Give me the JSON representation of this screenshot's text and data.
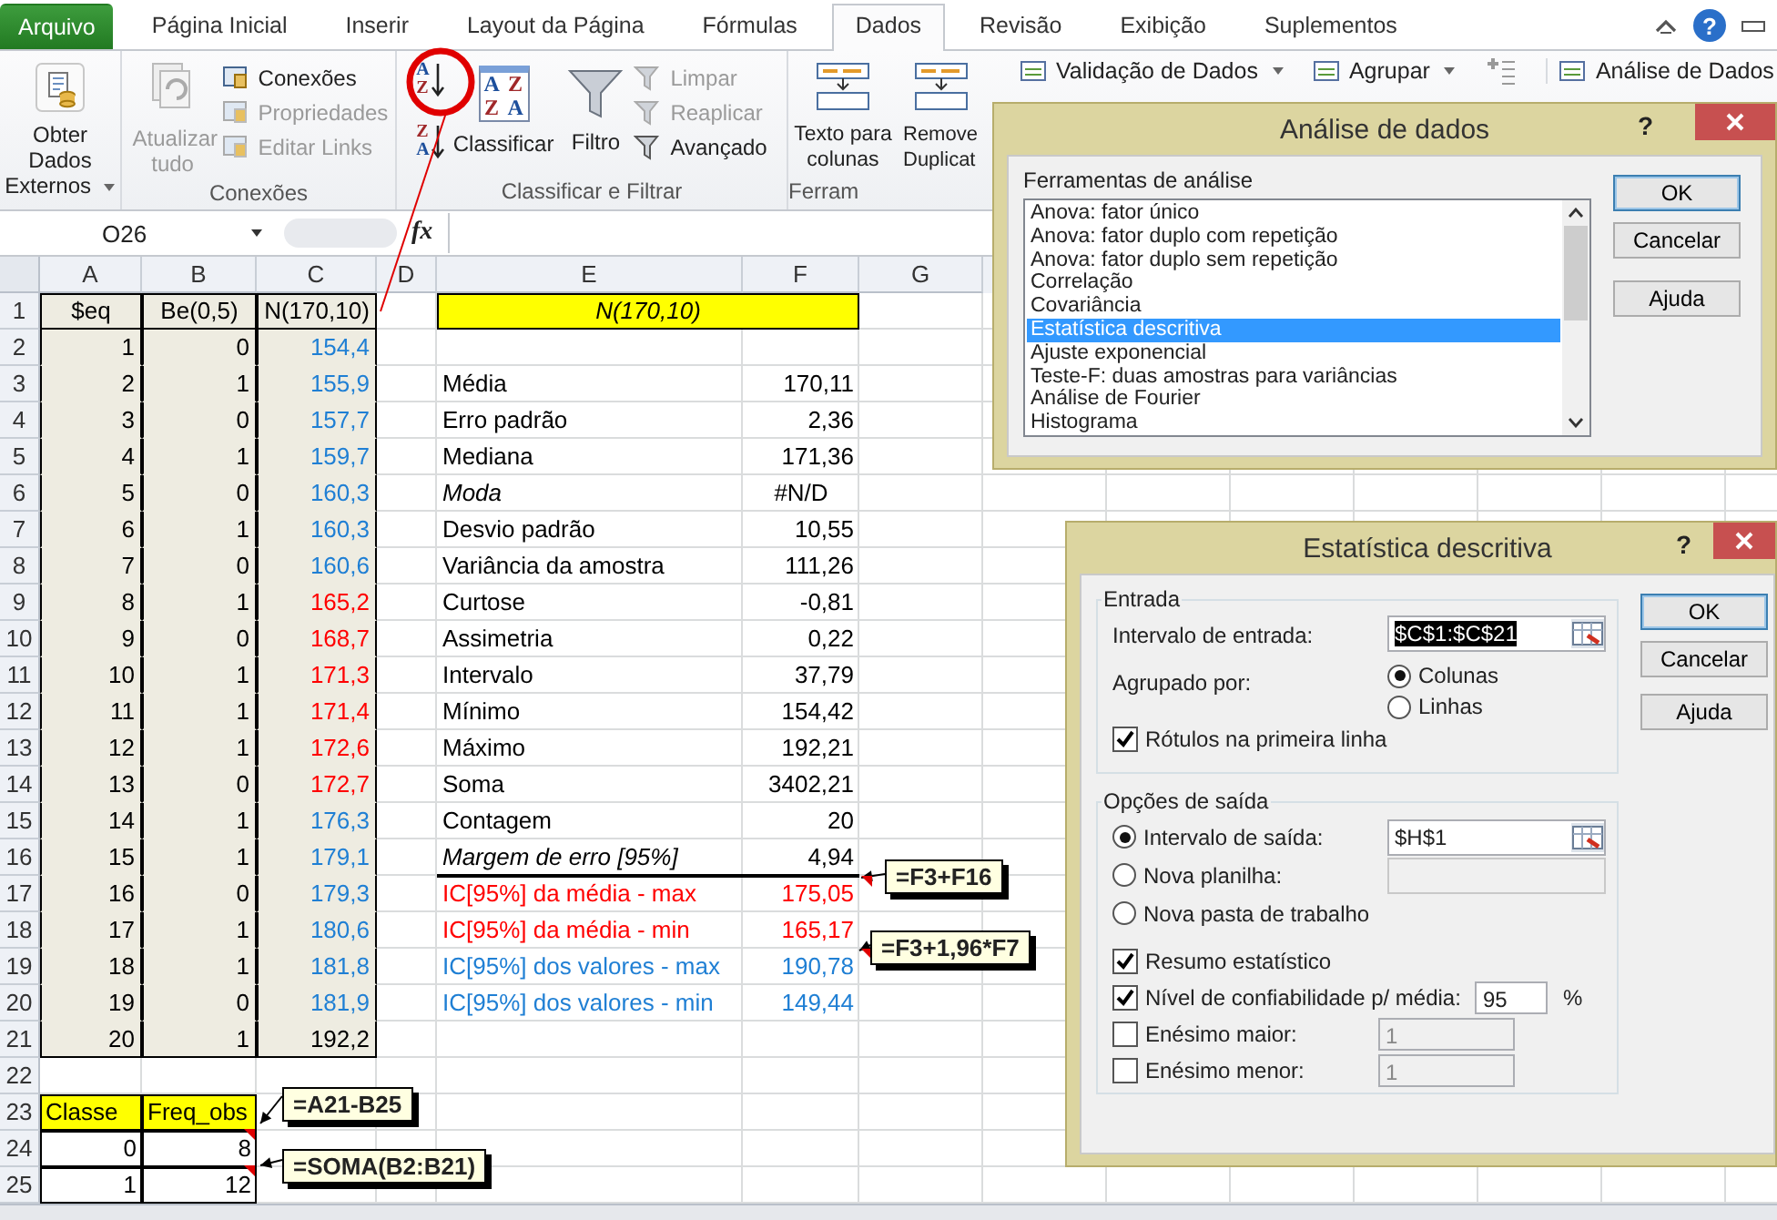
{
  "tabs": [
    {
      "label": "Arquivo",
      "kind": "file",
      "selected": false
    },
    {
      "label": "Página Inicial",
      "kind": "tab",
      "selected": false
    },
    {
      "label": "Inserir",
      "kind": "tab",
      "selected": false
    },
    {
      "label": "Layout da Página",
      "kind": "tab",
      "selected": false
    },
    {
      "label": "Fórmulas",
      "kind": "tab",
      "selected": false
    },
    {
      "label": "Dados",
      "kind": "tab",
      "selected": true
    },
    {
      "label": "Revisão",
      "kind": "tab",
      "selected": false
    },
    {
      "label": "Exibição",
      "kind": "tab",
      "selected": false
    },
    {
      "label": "Suplementos",
      "kind": "tab",
      "selected": false
    }
  ],
  "help": "?",
  "ribbon": {
    "external": {
      "label": "Obter Dados Externos"
    },
    "connections": {
      "refresh": {
        "label": "Atualizar tudo",
        "disabled": true
      },
      "items": [
        {
          "label": "Conexões",
          "disabled": false
        },
        {
          "label": "Propriedades",
          "disabled": true
        },
        {
          "label": "Editar Links",
          "disabled": true
        }
      ],
      "group_label": "Conexões"
    },
    "sort_filter": {
      "sort_buttons": [
        {
          "letters": [
            "A",
            "Z"
          ]
        },
        {
          "letters": [
            "Z",
            "A"
          ]
        }
      ],
      "sort": {
        "label": "Classificar",
        "letters": [
          "A",
          "Z",
          "Z",
          "A"
        ]
      },
      "filter": {
        "label": "Filtro"
      },
      "items": [
        {
          "label": "Limpar",
          "disabled": true
        },
        {
          "label": "Reaplicar",
          "disabled": true
        },
        {
          "label": "Avançado",
          "disabled": false
        }
      ],
      "group_label": "Classificar e Filtrar"
    },
    "tools": {
      "items": [
        {
          "label": "Texto para colunas"
        },
        {
          "label": "Remove Duplicat"
        }
      ],
      "group_label": "Ferram"
    },
    "right_items": [
      {
        "label": "Validação de Dados",
        "dropdown": true
      },
      {
        "label": "Agrupar",
        "dropdown": true
      },
      {
        "label": "Análise de Dados",
        "dropdown": false
      }
    ]
  },
  "formula_bar": {
    "name_box": "O26",
    "fx": "fx"
  },
  "sheet": {
    "columns": [
      "A",
      "B",
      "C",
      "D",
      "E",
      "F",
      "G"
    ],
    "rows": [
      {
        "number": "1",
        "cells": [
          {
            "text": "$eq",
            "kind": "head"
          },
          {
            "text": "Be(0,5)",
            "kind": "head"
          },
          {
            "text": "N(170,10)",
            "kind": "head"
          },
          {},
          {
            "text": "N(170,10)",
            "kind": "merged-head"
          }
        ]
      },
      {
        "number": "2",
        "cells": [
          {
            "text": "1",
            "kind": "num"
          },
          {
            "text": "0",
            "kind": "num"
          },
          {
            "text": "154,4",
            "kind": "num",
            "color": "#1f7fd4"
          }
        ]
      },
      {
        "number": "3",
        "cells": [
          {
            "text": "2",
            "kind": "num"
          },
          {
            "text": "1",
            "kind": "num"
          },
          {
            "text": "155,9",
            "kind": "num",
            "color": "#1f7fd4"
          },
          {},
          {
            "text": "Média",
            "kind": "label"
          },
          {
            "text": "170,11",
            "kind": "value"
          }
        ]
      },
      {
        "number": "4",
        "cells": [
          {
            "text": "3",
            "kind": "num"
          },
          {
            "text": "0",
            "kind": "num"
          },
          {
            "text": "157,7",
            "kind": "num",
            "color": "#1f7fd4"
          },
          {},
          {
            "text": "Erro padrão",
            "kind": "label"
          },
          {
            "text": "2,36",
            "kind": "value"
          }
        ]
      },
      {
        "number": "5",
        "cells": [
          {
            "text": "4",
            "kind": "num"
          },
          {
            "text": "1",
            "kind": "num"
          },
          {
            "text": "159,7",
            "kind": "num",
            "color": "#1f7fd4"
          },
          {},
          {
            "text": "Mediana",
            "kind": "label"
          },
          {
            "text": "171,36",
            "kind": "value"
          }
        ]
      },
      {
        "number": "6",
        "cells": [
          {
            "text": "5",
            "kind": "num"
          },
          {
            "text": "0",
            "kind": "num"
          },
          {
            "text": "160,3",
            "kind": "num",
            "color": "#1f7fd4"
          },
          {},
          {
            "text": "Moda",
            "kind": "label",
            "italic": true
          },
          {
            "text": "#N/D",
            "kind": "center"
          }
        ]
      },
      {
        "number": "7",
        "cells": [
          {
            "text": "6",
            "kind": "num"
          },
          {
            "text": "1",
            "kind": "num"
          },
          {
            "text": "160,3",
            "kind": "num",
            "color": "#1f7fd4"
          },
          {},
          {
            "text": "Desvio padrão",
            "kind": "label"
          },
          {
            "text": "10,55",
            "kind": "value"
          }
        ]
      },
      {
        "number": "8",
        "cells": [
          {
            "text": "7",
            "kind": "num"
          },
          {
            "text": "0",
            "kind": "num"
          },
          {
            "text": "160,6",
            "kind": "num",
            "color": "#1f7fd4"
          },
          {},
          {
            "text": "Variância da amostra",
            "kind": "label"
          },
          {
            "text": "111,26",
            "kind": "value"
          }
        ]
      },
      {
        "number": "9",
        "cells": [
          {
            "text": "8",
            "kind": "num"
          },
          {
            "text": "1",
            "kind": "num"
          },
          {
            "text": "165,2",
            "kind": "num",
            "color": "#ff0000"
          },
          {},
          {
            "text": "Curtose",
            "kind": "label"
          },
          {
            "text": "-0,81",
            "kind": "value"
          }
        ]
      },
      {
        "number": "10",
        "cells": [
          {
            "text": "9",
            "kind": "num"
          },
          {
            "text": "0",
            "kind": "num"
          },
          {
            "text": "168,7",
            "kind": "num",
            "color": "#ff0000"
          },
          {},
          {
            "text": "Assimetria",
            "kind": "label"
          },
          {
            "text": "0,22",
            "kind": "value"
          }
        ]
      },
      {
        "number": "11",
        "cells": [
          {
            "text": "10",
            "kind": "num"
          },
          {
            "text": "1",
            "kind": "num"
          },
          {
            "text": "171,3",
            "kind": "num",
            "color": "#ff0000"
          },
          {},
          {
            "text": "Intervalo",
            "kind": "label"
          },
          {
            "text": "37,79",
            "kind": "value"
          }
        ]
      },
      {
        "number": "12",
        "cells": [
          {
            "text": "11",
            "kind": "num"
          },
          {
            "text": "1",
            "kind": "num"
          },
          {
            "text": "171,4",
            "kind": "num",
            "color": "#ff0000"
          },
          {},
          {
            "text": "Mínimo",
            "kind": "label"
          },
          {
            "text": "154,42",
            "kind": "value"
          }
        ]
      },
      {
        "number": "13",
        "cells": [
          {
            "text": "12",
            "kind": "num"
          },
          {
            "text": "1",
            "kind": "num"
          },
          {
            "text": "172,6",
            "kind": "num",
            "color": "#ff0000"
          },
          {},
          {
            "text": "Máximo",
            "kind": "label"
          },
          {
            "text": "192,21",
            "kind": "value"
          }
        ]
      },
      {
        "number": "14",
        "cells": [
          {
            "text": "13",
            "kind": "num"
          },
          {
            "text": "0",
            "kind": "num"
          },
          {
            "text": "172,7",
            "kind": "num",
            "color": "#ff0000"
          },
          {},
          {
            "text": "Soma",
            "kind": "label"
          },
          {
            "text": "3402,21",
            "kind": "value"
          }
        ]
      },
      {
        "number": "15",
        "cells": [
          {
            "text": "14",
            "kind": "num"
          },
          {
            "text": "1",
            "kind": "num"
          },
          {
            "text": "176,3",
            "kind": "num",
            "color": "#1f7fd4"
          },
          {},
          {
            "text": "Contagem",
            "kind": "label"
          },
          {
            "text": "20",
            "kind": "value"
          }
        ]
      },
      {
        "number": "16",
        "cells": [
          {
            "text": "15",
            "kind": "num"
          },
          {
            "text": "1",
            "kind": "num"
          },
          {
            "text": "179,1",
            "kind": "num",
            "color": "#1f7fd4"
          },
          {},
          {
            "text": "Margem de erro [95%]",
            "kind": "label",
            "italic": true,
            "ruled": true
          },
          {
            "text": "4,94",
            "kind": "value",
            "ruled": true
          }
        ]
      },
      {
        "number": "17",
        "cells": [
          {
            "text": "16",
            "kind": "num"
          },
          {
            "text": "0",
            "kind": "num"
          },
          {
            "text": "179,3",
            "kind": "num",
            "color": "#1f7fd4"
          },
          {},
          {
            "text": "IC[95%] da média - max",
            "kind": "label",
            "color": "#ff0000"
          },
          {
            "text": "175,05",
            "kind": "value",
            "color": "#ff0000"
          }
        ]
      },
      {
        "number": "18",
        "cells": [
          {
            "text": "17",
            "kind": "num"
          },
          {
            "text": "1",
            "kind": "num"
          },
          {
            "text": "180,6",
            "kind": "num",
            "color": "#1f7fd4"
          },
          {},
          {
            "text": "IC[95%] da média - min",
            "kind": "label",
            "color": "#ff0000"
          },
          {
            "text": "165,17",
            "kind": "value",
            "color": "#ff0000"
          }
        ]
      },
      {
        "number": "19",
        "cells": [
          {
            "text": "18",
            "kind": "num"
          },
          {
            "text": "1",
            "kind": "num"
          },
          {
            "text": "181,8",
            "kind": "num",
            "color": "#1f7fd4"
          },
          {},
          {
            "text": "IC[95%] dos valores - max",
            "kind": "label",
            "color": "#1f7fd4"
          },
          {
            "text": "190,78",
            "kind": "value",
            "color": "#1f7fd4"
          }
        ]
      },
      {
        "number": "20",
        "cells": [
          {
            "text": "19",
            "kind": "num"
          },
          {
            "text": "0",
            "kind": "num"
          },
          {
            "text": "181,9",
            "kind": "num",
            "color": "#1f7fd4"
          },
          {},
          {
            "text": "IC[95%] dos valores - min",
            "kind": "label",
            "color": "#1f7fd4"
          },
          {
            "text": "149,44",
            "kind": "value",
            "color": "#1f7fd4"
          }
        ]
      },
      {
        "number": "21",
        "cells": [
          {
            "text": "20",
            "kind": "num"
          },
          {
            "text": "1",
            "kind": "num"
          },
          {
            "text": "192,2",
            "kind": "num"
          }
        ]
      },
      {
        "number": "22",
        "cells": []
      },
      {
        "number": "23",
        "cells": [
          {
            "text": "Classe",
            "kind": "yellow-head"
          },
          {
            "text": "Freq_obs",
            "kind": "yellow-head"
          }
        ]
      },
      {
        "number": "24",
        "cells": [
          {
            "text": "0",
            "kind": "boxed"
          },
          {
            "text": "8",
            "kind": "boxed"
          }
        ]
      },
      {
        "number": "25",
        "cells": [
          {
            "text": "1",
            "kind": "boxed"
          },
          {
            "text": "12",
            "kind": "boxed"
          }
        ]
      }
    ]
  },
  "callouts": [
    {
      "text": "=F3+F16"
    },
    {
      "text": "=F3+1,96*F7"
    },
    {
      "text": "=A21-B25"
    },
    {
      "text": "=SOMA(B2:B21)"
    }
  ],
  "analysis_dialog": {
    "title": "Análise de dados",
    "help": "?",
    "list_label": "Ferramentas de análise",
    "items": [
      {
        "label": "Anova: fator único",
        "selected": false
      },
      {
        "label": "Anova: fator duplo com repetição",
        "selected": false
      },
      {
        "label": "Anova: fator duplo sem repetição",
        "selected": false
      },
      {
        "label": "Correlação",
        "selected": false
      },
      {
        "label": "Covariância",
        "selected": false
      },
      {
        "label": "Estatística descritiva",
        "selected": true
      },
      {
        "label": "Ajuste exponencial",
        "selected": false
      },
      {
        "label": "Teste-F: duas amostras para variâncias",
        "selected": false
      },
      {
        "label": "Análise de Fourier",
        "selected": false
      },
      {
        "label": "Histograma",
        "selected": false
      }
    ],
    "buttons": [
      {
        "label": "OK",
        "kind": "default"
      },
      {
        "label": "Cancelar",
        "kind": "normal"
      },
      {
        "label": "Ajuda",
        "kind": "normal"
      }
    ]
  },
  "stats_dialog": {
    "title": "Estatística descritiva",
    "help": "?",
    "input": {
      "legend": "Entrada",
      "range_label": "Intervalo de entrada:",
      "range_value": "$C$1:$C$21",
      "range_selected": true,
      "group_label": "Agrupado por:",
      "group_options": [
        {
          "label": "Colunas",
          "selected": true
        },
        {
          "label": "Linhas",
          "selected": false
        }
      ],
      "labels_check": {
        "label": "Rótulos na primeira linha",
        "checked": true
      }
    },
    "output": {
      "legend": "Opções de saída",
      "options": [
        {
          "label": "Intervalo de saída:",
          "selected": true,
          "kind": "ref",
          "value": "$H$1"
        },
        {
          "label": "Nova planilha:",
          "selected": false,
          "kind": "field"
        },
        {
          "label": "Nova pasta de trabalho",
          "selected": false,
          "kind": "plain"
        }
      ],
      "checks": [
        {
          "label": "Resumo estatístico",
          "checked": true,
          "kind": "plain"
        },
        {
          "label": "Nível de confiabilidade p/ média:",
          "checked": true,
          "kind": "percent",
          "value": "95",
          "unit": "%"
        },
        {
          "label": "Enésimo maior:",
          "checked": false,
          "kind": "number",
          "value": "1"
        },
        {
          "label": "Enésimo menor:",
          "checked": false,
          "kind": "number",
          "value": "1"
        }
      ]
    },
    "buttons": [
      {
        "label": "OK",
        "kind": "default"
      },
      {
        "label": "Cancelar",
        "kind": "normal"
      },
      {
        "label": "Ajuda",
        "kind": "normal"
      }
    ]
  }
}
